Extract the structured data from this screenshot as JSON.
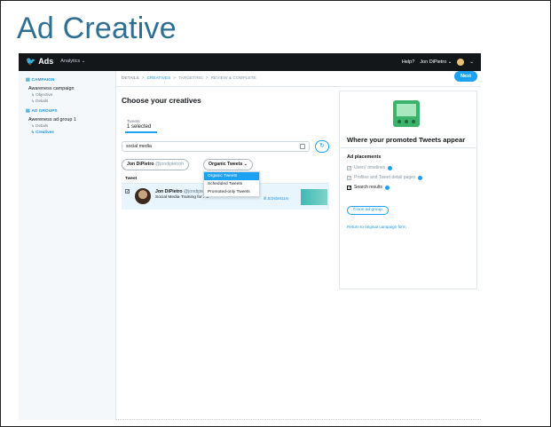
{
  "slide": {
    "title": "Ad Creative"
  },
  "topbar": {
    "brand": "Ads",
    "analytics": "Analytics ⌄",
    "help": "Help?",
    "user": "Jon DiPietro ⌄",
    "avatar_caret": "⌄"
  },
  "sidebar": {
    "campaign_head": "CAMPAIGN",
    "campaign_name": "Awareness campaign",
    "campaign_items": [
      "↳ Objective",
      "↳ Details"
    ],
    "adgroups_head": "AD GROUPS",
    "adgroup_name": "Awereness ad group 1",
    "adgroup_items": [
      "↳ Details",
      "↳ Creatives"
    ]
  },
  "steps": {
    "s1": "DETAILS",
    "s2": "CREATIVES",
    "s3": "TARGETING",
    "s4": "REVIEW & COMPLETE",
    "sep": ">"
  },
  "next_label": "Next",
  "main": {
    "heading": "Choose your creatives",
    "tab_label": "Tweets",
    "tab_value": "1 selected",
    "search_value": "social media",
    "refresh_icon": "↻"
  },
  "filters": {
    "user_name": "Jon DiPietro",
    "user_handle": "@jondipietroh",
    "type_label": "Organic Tweets",
    "type_caret": "⌄"
  },
  "dropdown": {
    "options": [
      "Organic Tweets",
      "Scheduled Tweets",
      "Promoted-only Tweets"
    ],
    "selected_index": 0
  },
  "tweet": {
    "header": "Tweet",
    "name": "Jon DiPietro",
    "handle": "@jondipiet",
    "text": "Social Media Training for Po",
    "link": "ift.tt/2sbM11m"
  },
  "panel": {
    "title": "Where your promoted Tweets appear",
    "placements_head": "Ad placements",
    "placements": [
      {
        "label": "Users' timelines",
        "checked": false,
        "info": true
      },
      {
        "label": "Profiles and Tweet detail pages",
        "checked": false,
        "info": true
      },
      {
        "label": "Search results",
        "checked": true,
        "info": true
      }
    ],
    "clone_label": "Clone ad group",
    "return_label": "Return to original campaign form"
  },
  "colors": {
    "accent": "#1da1f2",
    "title_blue": "#2e6f94",
    "topbar": "#14171a",
    "promo_green": "#3bb36b"
  },
  "icons": [
    "twitter-bird-icon",
    "campaign-icon",
    "adgroups-icon",
    "search-icon",
    "refresh-icon",
    "info-icon",
    "chevron-down-icon"
  ]
}
